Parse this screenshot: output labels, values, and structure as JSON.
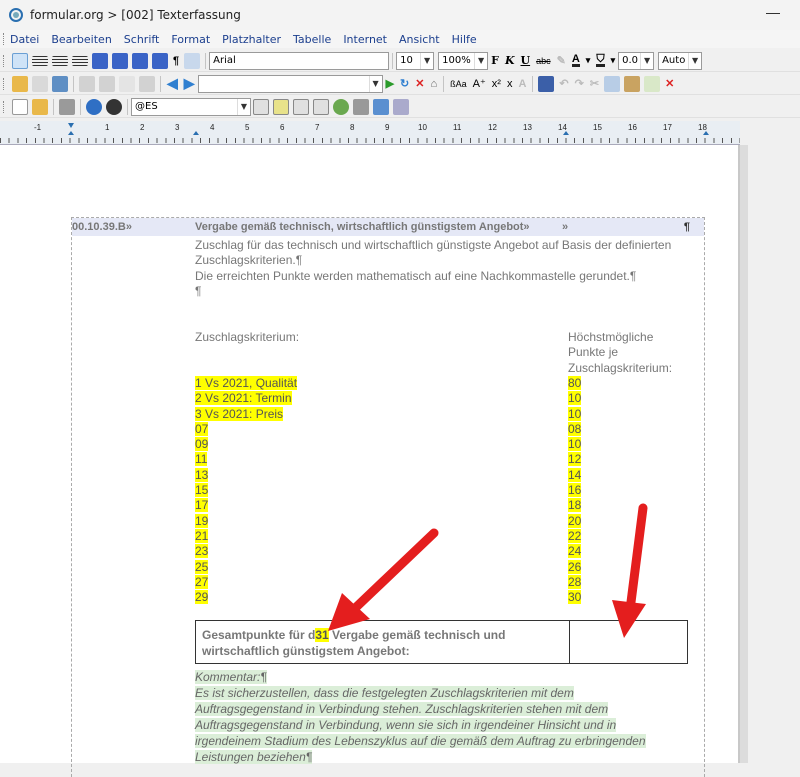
{
  "window": {
    "title": "formular.org > [002] Texterfassung",
    "minimize": "—"
  },
  "menu": [
    "Datei",
    "Bearbeiten",
    "Schrift",
    "Format",
    "Platzhalter",
    "Tabelle",
    "Internet",
    "Ansicht",
    "Hilfe"
  ],
  "format_toolbar": {
    "font": "Arial",
    "size": "10",
    "zoom": "100%",
    "spacing": "0.0",
    "auto": "Auto"
  },
  "tb2_combo": "",
  "tb3_combo": "@ES",
  "ruler": {
    "numbers": [
      "-1",
      "1",
      "2",
      "3",
      "4",
      "5",
      "6",
      "7",
      "8",
      "9",
      "10",
      "11",
      "12",
      "13",
      "14",
      "15",
      "16",
      "17",
      "18"
    ]
  },
  "doc": {
    "pos_number": "00.10.39.B»",
    "pos_title": "Vergabe gemäß technisch, wirtschaftlich günstigstem Angebot»",
    "pos_marker": "»",
    "pilcrow": "¶",
    "intro_lines": [
      "Zuschlag für das technisch und wirtschaftlich günstigste Angebot auf Basis der definierten",
      "Zuschlagskriterien.¶",
      "Die erreichten Punkte werden mathematisch auf eine Nachkommastelle gerundet.¶",
      "¶"
    ],
    "col_left_header": "Zuschlagskriterium:",
    "col_right_header": [
      "Höchstmögliche",
      "Punkte je",
      "Zuschlagskriterium:"
    ],
    "criteria": [
      "1 Vs 2021, Qualität",
      "2 Vs 2021: Termin",
      "3 Vs 2021: Preis",
      "07",
      "09",
      "11",
      "13",
      "15",
      "17",
      "19",
      "21",
      "23",
      "25",
      "27",
      "29"
    ],
    "points": [
      "80",
      "10",
      "10",
      "08",
      "10",
      "12",
      "14",
      "16",
      "18",
      "20",
      "22",
      "24",
      "26",
      "28",
      "30"
    ],
    "total_label_1a": "Gesamtpunkte für d",
    "total_label_hl": "31",
    "total_label_1b": " Vergabe gemäß technisch und",
    "total_label_2": "wirtschaftlich günstigstem Angebot:",
    "comment_lines": [
      "Kommentar:¶",
      "Es ist sicherzustellen, dass die festgelegten Zuschlagskriterien mit dem",
      "Auftragsgegenstand in Verbindung stehen. Zuschlagskriterien stehen mit dem",
      "Auftragsgegenstand in Verbindung, wenn sie sich in irgendeiner Hinsicht und in",
      "irgendeinem Stadium des Lebenszyklus auf die gemäß dem Auftrag zu erbringenden",
      "Leistungen beziehen¶"
    ]
  },
  "colors": {
    "highlight": "#ffff00",
    "arrow": "#e41e1e",
    "comment_bg": "#dbeed8",
    "header_bg": "#e5e8f6"
  }
}
